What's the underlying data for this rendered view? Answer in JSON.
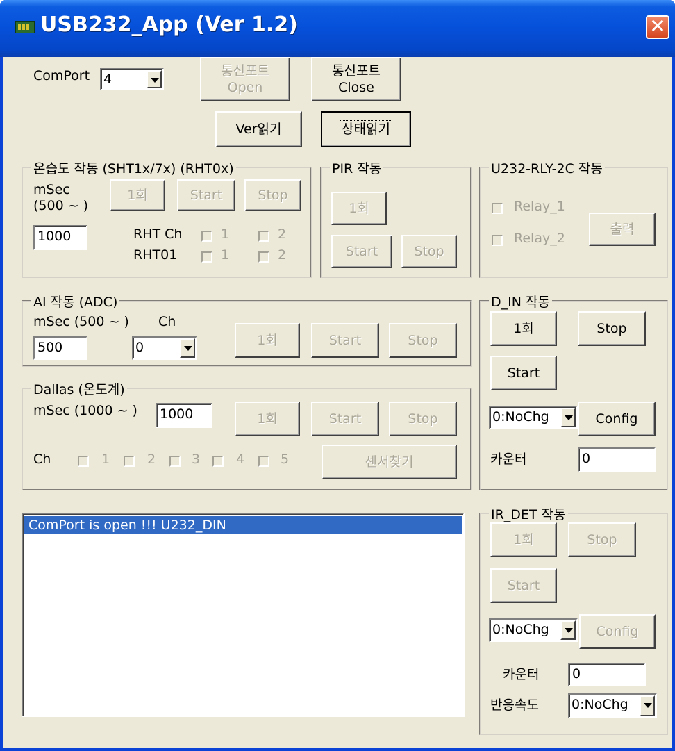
{
  "window": {
    "title": "USB232_App (Ver 1.2)",
    "close_glyph": "✕"
  },
  "comport": {
    "label": "ComPort",
    "value": "4",
    "open_line1": "통신포트",
    "open_line2": "Open",
    "close_line1": "통신포트",
    "close_line2": "Close",
    "ver_read": "Ver읽기",
    "state_read": "상태읽기"
  },
  "rht": {
    "legend": "온습도 작동 (SHT1x/7x) (RHT0x)",
    "msec_line1": "mSec",
    "msec_line2": "(500 ~ )",
    "once": "1회",
    "start": "Start",
    "stop": "Stop",
    "interval": "1000",
    "rht_ch": "RHT Ch",
    "rht01": "RHT01",
    "ch1": "1",
    "ch2": "2"
  },
  "pir": {
    "legend": "PIR 작동",
    "once": "1회",
    "start": "Start",
    "stop": "Stop"
  },
  "relay": {
    "legend": "U232-RLY-2C 작동",
    "relay1": "Relay_1",
    "relay2": "Relay_2",
    "output": "출력"
  },
  "ai": {
    "legend": "AI 작동 (ADC)",
    "msec": "mSec (500 ~ )",
    "ch": "Ch",
    "interval": "500",
    "channel": "0",
    "once": "1회",
    "start": "Start",
    "stop": "Stop"
  },
  "dallas": {
    "legend": "Dallas (온도계)",
    "msec": "mSec (1000 ~ )",
    "interval": "1000",
    "ch": "Ch",
    "channels": [
      "1",
      "2",
      "3",
      "4",
      "5"
    ],
    "once": "1회",
    "start": "Start",
    "stop": "Stop",
    "find": "센서찾기"
  },
  "din": {
    "legend": "D_IN 작동",
    "once": "1회",
    "stop": "Stop",
    "start": "Start",
    "mode": "0:NoChg",
    "config": "Config",
    "counter_label": "카운터",
    "counter_value": "0"
  },
  "irdet": {
    "legend": "IR_DET 작동",
    "once": "1회",
    "stop": "Stop",
    "start": "Start",
    "mode": "0:NoChg",
    "config": "Config",
    "counter_label": "카운터",
    "counter_value": "0",
    "speed_label": "반응속도",
    "speed_value": "0:NoChg"
  },
  "log": {
    "lines": [
      "ComPort is open !!! U232_DIN"
    ]
  }
}
